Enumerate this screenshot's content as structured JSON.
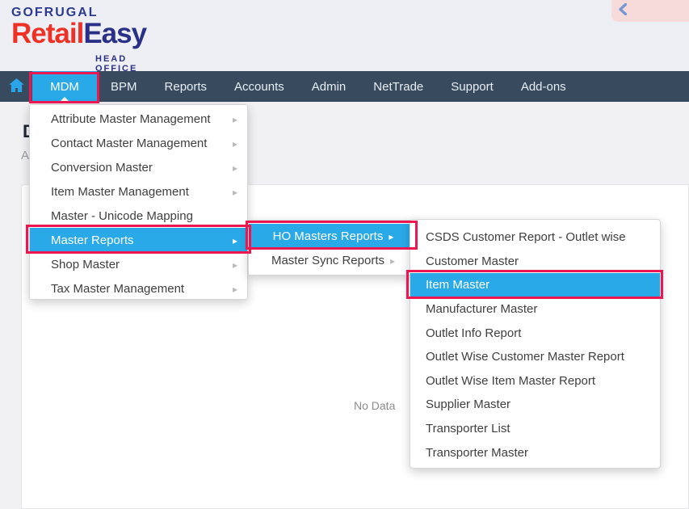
{
  "header": {
    "logo": {
      "company": "GOFRUGAL",
      "product_part1": "Retail",
      "product_part2": "Easy",
      "edition": "HEAD OFFICE"
    },
    "collapse_icon": "chevron-left"
  },
  "navbar": {
    "items": [
      {
        "label": "MDM",
        "active": true
      },
      {
        "label": "BPM"
      },
      {
        "label": "Reports"
      },
      {
        "label": "Accounts"
      },
      {
        "label": "Admin"
      },
      {
        "label": "NetTrade"
      },
      {
        "label": "Support"
      },
      {
        "label": "Add-ons"
      }
    ]
  },
  "page": {
    "heading_fragment": "D",
    "subheading_fragment": "A",
    "empty_state_text": "No Data"
  },
  "menus": {
    "mdm": {
      "items": [
        {
          "label": "Attribute Master Management",
          "has_submenu": true
        },
        {
          "label": "Contact Master Management",
          "has_submenu": true
        },
        {
          "label": "Conversion Master",
          "has_submenu": true
        },
        {
          "label": "Item Master Management",
          "has_submenu": true
        },
        {
          "label": "Master - Unicode Mapping",
          "has_submenu": false
        },
        {
          "label": "Master Reports",
          "has_submenu": true,
          "highlighted": true,
          "annotated": true
        },
        {
          "label": "Shop Master",
          "has_submenu": true
        },
        {
          "label": "Tax Master Management",
          "has_submenu": true
        }
      ]
    },
    "master_reports": {
      "items": [
        {
          "label": "HO Masters Reports",
          "has_submenu": true,
          "highlighted": true,
          "annotated": true
        },
        {
          "label": "Master Sync Reports",
          "has_submenu": true
        }
      ]
    },
    "ho_masters_reports": {
      "items": [
        {
          "label": "CSDS Customer Report - Outlet wise"
        },
        {
          "label": "Customer Master"
        },
        {
          "label": "Item Master",
          "highlighted": true,
          "annotated": true
        },
        {
          "label": "Manufacturer Master"
        },
        {
          "label": "Outlet Info Report"
        },
        {
          "label": "Outlet Wise Customer Master Report"
        },
        {
          "label": "Outlet Wise Item Master Report"
        },
        {
          "label": "Supplier Master"
        },
        {
          "label": "Transporter List"
        },
        {
          "label": "Transporter Master"
        }
      ]
    }
  },
  "colors": {
    "highlight_blue": "#29a9e8",
    "annotation_red": "#ec1651",
    "navbar_bg": "#374a5e",
    "logo_red": "#ee3124",
    "logo_navy": "#2b3087",
    "header_bg": "#edeff5",
    "collapse_box_pink": "#f7dbdb"
  }
}
